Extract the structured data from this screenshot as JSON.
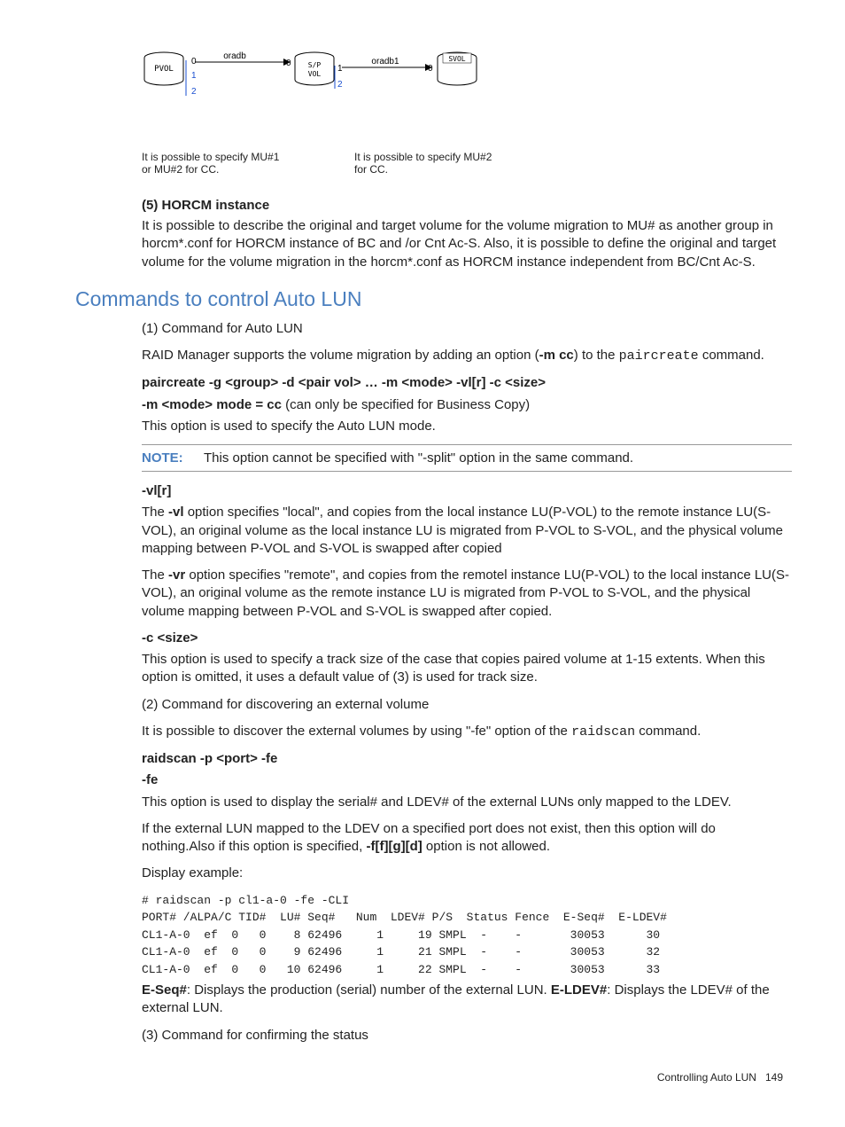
{
  "diagram": {
    "pvol_label": "PVOL",
    "spvol_label": "S/P VOL",
    "svol_label": "SVOL",
    "link1": "oradb",
    "link2": "oradb1",
    "num0": "0",
    "num1": "1",
    "num2": "2",
    "caption_left": "It is possible to specify MU#1 or MU#2 for CC.",
    "caption_right": "It is possible to specify MU#2 for CC."
  },
  "sec5": {
    "title": "(5) HORCM instance",
    "para": "It is possible to describe the original and target volume for the volume migration to MU# as another group in horcm*.conf for HORCM instance of BC and /or Cnt Ac-S. Also, it is possible to define the original and target volume for the volume migration in the horcm*.conf as HORCM instance independent from BC/Cnt Ac-S."
  },
  "commands_heading": "Commands to control Auto LUN",
  "cmd1": {
    "title": "(1) Command for Auto LUN",
    "intro_pre": "RAID Manager supports the volume migration by adding an option (",
    "intro_opt": "-m cc",
    "intro_mid": ") to the ",
    "intro_cmd": "paircreate",
    "intro_post": " command.",
    "syntax": "paircreate -g <group> -d <pair vol> … -m <mode> -vl[r] -c <size>",
    "mode_line_bold": "-m <mode> mode = cc",
    "mode_line_rest": " (can only be specified for Business Copy)",
    "mode_desc": "This option is used to specify the Auto LUN mode.",
    "note_label": "NOTE:",
    "note_text": "This option cannot be specified with \"-split\" option in the same command.",
    "vlr_head": "-vl[r]",
    "vl_para_pre": "The ",
    "vl_bold": "-vl",
    "vl_para_post": " option specifies \"local\", and copies from the local instance LU(P-VOL) to the remote instance LU(S-VOL), an original volume as the local instance LU is migrated from P-VOL to S-VOL, and the physical volume mapping between P-VOL and S-VOL is swapped after copied",
    "vr_para_pre": "The ",
    "vr_bold": "-vr",
    "vr_para_post": " option specifies \"remote\", and copies from the remotel instance LU(P-VOL) to the local instance LU(S-VOL), an original volume as the remote instance LU is migrated from P-VOL to S-VOL, and the physical volume mapping between P-VOL and S-VOL is swapped after copied.",
    "csize_head": "-c <size>",
    "csize_para": "This option is used to specify a track size of the case that copies paired volume at 1-15 extents. When this option is omitted, it uses a default value of (3) is used for track size."
  },
  "cmd2": {
    "title": "(2) Command for discovering an external volume",
    "intro_pre": "It is possible to discover the external volumes by using \"-fe\" option of the ",
    "intro_cmd": "raidscan",
    "intro_post": " command.",
    "syntax": "raidscan -p <port> -fe",
    "fe_head": "-fe",
    "fe_para": "This option is used to display the serial# and LDEV# of the external LUNs only mapped to the LDEV.",
    "fe_para2_pre": "If the external LUN mapped to the LDEV on a specified port does not exist, then this option will do nothing.Also if this option is specified, ",
    "fe_para2_bold": "-f[f][g][d]",
    "fe_para2_post": " option is not allowed.",
    "display_ex": "Display example:"
  },
  "code": "# raidscan -p cl1-a-0 -fe -CLI\nPORT# /ALPA/C TID#  LU# Seq#   Num  LDEV# P/S  Status Fence  E-Seq#  E-LDEV#\nCL1-A-0  ef  0   0    8 62496     1     19 SMPL  -    -       30053      30\nCL1-A-0  ef  0   0    9 62496     1     21 SMPL  -    -       30053      32\nCL1-A-0  ef  0   0   10 62496     1     22 SMPL  -    -       30053      33",
  "post_code": {
    "eseq_bold": "E-Seq#",
    "eseq_text": ": Displays the production (serial) number of the external LUN. ",
    "eldev_bold": "E-LDEV#",
    "eldev_text": ": Displays the LDEV# of the external LUN."
  },
  "cmd3_title": "(3) Command for confirming the status",
  "footer_text": "Controlling Auto LUN",
  "footer_page": "149"
}
